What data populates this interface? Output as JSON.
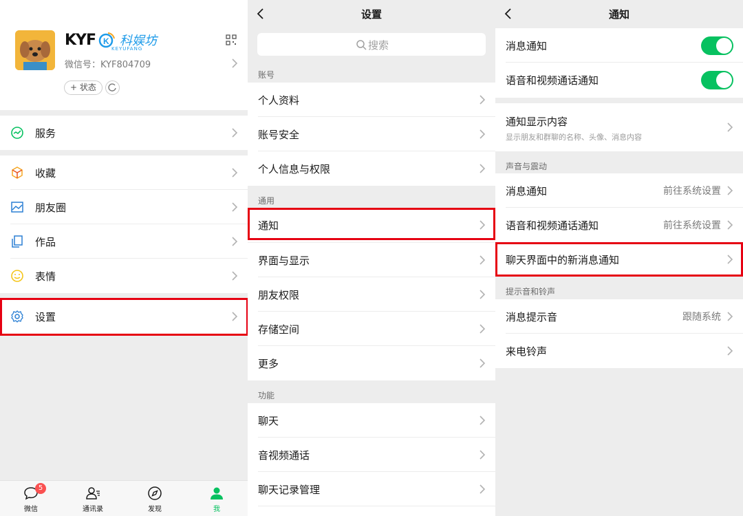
{
  "me": {
    "brand": "KYF",
    "brand_cn": "科娱坊",
    "brand_en": "KEYUFANG",
    "wechat_id": "微信号：KYF804709",
    "status_label": "+ 状态",
    "menu": {
      "services": "服务",
      "favorites": "收藏",
      "moments": "朋友圈",
      "works": "作品",
      "stickers": "表情",
      "settings": "设置"
    },
    "tabs": {
      "chats": "微信",
      "chats_badge": "5",
      "contacts": "通讯录",
      "discover": "发现",
      "me": "我"
    }
  },
  "settings": {
    "title": "设置",
    "search_placeholder": "搜索",
    "section_account": "账号",
    "profile": "个人资料",
    "account_security": "账号安全",
    "privacy": "个人信息与权限",
    "section_general": "通用",
    "notifications": "通知",
    "display": "界面与显示",
    "friend_perms": "朋友权限",
    "storage": "存储空间",
    "more": "更多",
    "section_features": "功能",
    "chat": "聊天",
    "av_call": "音视频通话",
    "chat_history": "聊天记录管理"
  },
  "notify": {
    "title": "通知",
    "msg_notify": "消息通知",
    "msg_notify_on": true,
    "av_notify": "语音和视频通话通知",
    "av_notify_on": true,
    "display_content": "通知显示内容",
    "display_content_sub": "显示朋友和群聊的名称、头像、消息内容",
    "section_sound": "声音与震动",
    "sound_msg": "消息通知",
    "sound_msg_value": "前往系统设置",
    "sound_av": "语音和视频通话通知",
    "sound_av_value": "前往系统设置",
    "chat_new_msg": "聊天界面中的新消息通知",
    "section_tones": "提示音和铃声",
    "msg_tone": "消息提示音",
    "msg_tone_value": "跟随系统",
    "ringtone": "来电铃声"
  },
  "colors": {
    "accent": "#07c160",
    "highlight": "#e60012"
  }
}
